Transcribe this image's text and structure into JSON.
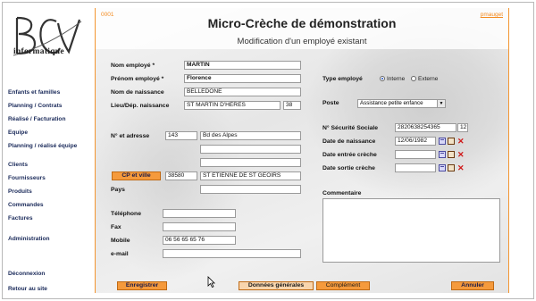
{
  "sidebar": {
    "logo_text": "informatique",
    "items": [
      {
        "label": "Enfants et familles"
      },
      {
        "label": "Planning / Contrats"
      },
      {
        "label": "Réalisé / Facturation"
      },
      {
        "label": "Equipe"
      },
      {
        "label": "Planning / réalisé équipe"
      },
      {
        "label": "Clients"
      },
      {
        "label": "Fournisseurs"
      },
      {
        "label": "Produits"
      },
      {
        "label": "Commandes"
      },
      {
        "label": "Factures"
      },
      {
        "label": "Administration"
      },
      {
        "label": "Déconnexion"
      },
      {
        "label": "Retour au site"
      }
    ]
  },
  "header": {
    "page_id": "0001",
    "user": "pmauget",
    "title": "Micro-Crèche de démonstration",
    "subtitle": "Modification d'un employé existant"
  },
  "form": {
    "nom_label": "Nom employé *",
    "nom_value": "MARTIN",
    "prenom_label": "Prénom employé *",
    "prenom_value": "Florence",
    "naissance_nom_label": "Nom de naissance",
    "naissance_nom_value": "BELLEDONE",
    "lieu_label": "Lieu/Dép. naissance",
    "lieu_value": "ST MARTIN D'HÈRES",
    "dep_value": "38",
    "adresse_label": "N° et adresse",
    "adresse_num": "143",
    "adresse_rue": "Bd des Alpes",
    "adresse_l2": "",
    "adresse_l3": "",
    "cp_button": "CP et ville",
    "cp_value": "38580",
    "ville_value": "ST ETIENNE DE ST GEOIRS",
    "pays_label": "Pays",
    "pays_value": "",
    "telephone_label": "Téléphone",
    "telephone_value": "",
    "fax_label": "Fax",
    "fax_value": "",
    "mobile_label": "Mobile",
    "mobile_value": "06 56 65 65 76",
    "email_label": "e-mail",
    "email_value": "",
    "type_label": "Type employé",
    "type_interne": "Interne",
    "type_externe": "Externe",
    "poste_label": "Poste",
    "poste_value": "Assistance petite enfance",
    "secu_label": "N° Sécurité Sociale",
    "secu_value": "2820638254365",
    "secu_key": "12",
    "date_naissance_label": "Date de naissance",
    "date_naissance_value": "12/06/1982",
    "date_entree_label": "Date entrée crèche",
    "date_entree_value": "",
    "date_sortie_label": "Date sortie crèche",
    "date_sortie_value": "",
    "commentaire_label": "Commentaire"
  },
  "footer": {
    "enregistrer": "Enregistrer",
    "donnees": "Données générales",
    "complement": "Complément",
    "annuler": "Annuler"
  }
}
